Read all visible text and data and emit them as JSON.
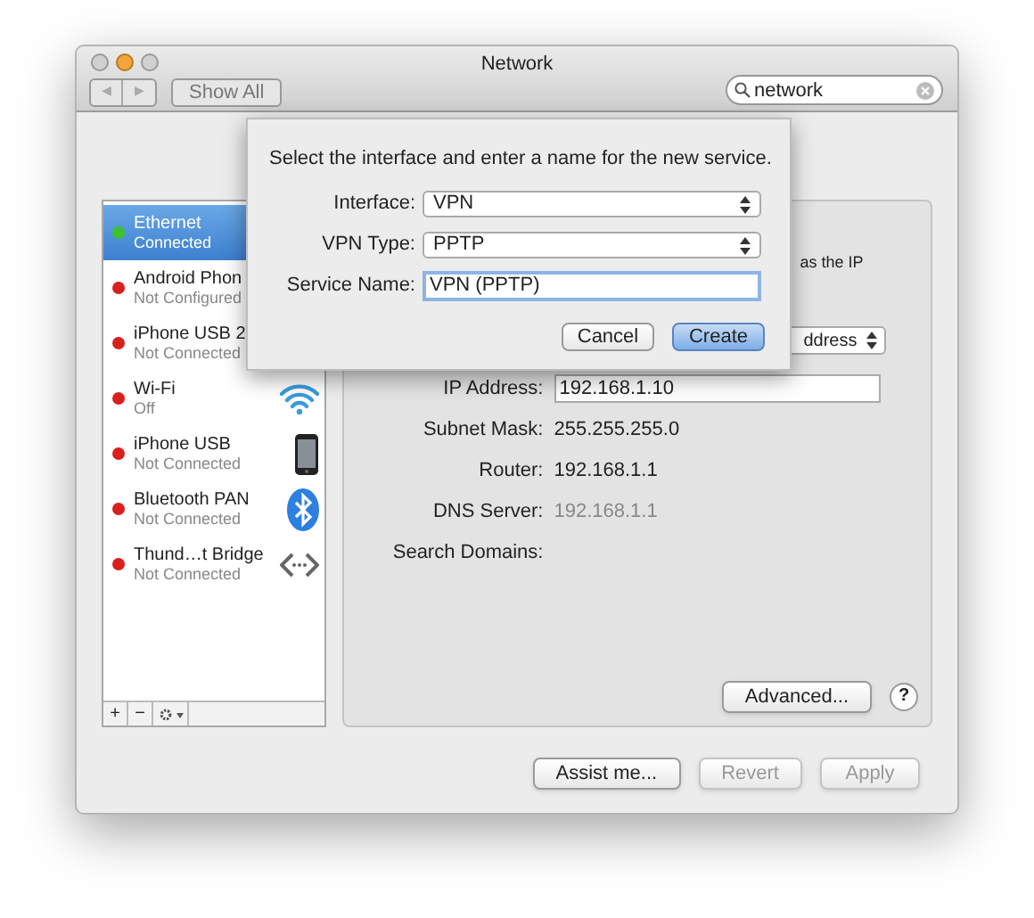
{
  "window": {
    "title": "Network"
  },
  "toolbar": {
    "back": "◀",
    "forward": "▶",
    "show_all": "Show All",
    "search": {
      "value": "network"
    }
  },
  "sidebar": {
    "items": [
      {
        "name": "Ethernet",
        "status": "Connected",
        "color": "#3ec22b",
        "selected": true,
        "kind": "none"
      },
      {
        "name": "Android Phon",
        "status": "Not Configured",
        "color": "#d9201c",
        "selected": false,
        "kind": "none"
      },
      {
        "name": "iPhone USB 2",
        "status": "Not Connected",
        "color": "#d9201c",
        "selected": false,
        "kind": "none"
      },
      {
        "name": "Wi-Fi",
        "status": "Off",
        "color": "#d9201c",
        "selected": false,
        "kind": "wifi"
      },
      {
        "name": "iPhone USB",
        "status": "Not Connected",
        "color": "#d9201c",
        "selected": false,
        "kind": "phone"
      },
      {
        "name": "Bluetooth PAN",
        "status": "Not Connected",
        "color": "#d9201c",
        "selected": false,
        "kind": "bluetooth"
      },
      {
        "name": "Thund…t Bridge",
        "status": "Not Connected",
        "color": "#d9201c",
        "selected": false,
        "kind": "bridge"
      }
    ],
    "buttons": [
      "+",
      "−"
    ]
  },
  "details": {
    "status_fragment": "as the IP",
    "configure_fragment": "ddress",
    "fields": [
      {
        "label": "IP Address:",
        "value": "192.168.1.10",
        "kind": "field",
        "disabled": false
      },
      {
        "label": "Subnet Mask:",
        "value": "255.255.255.0",
        "kind": "text",
        "disabled": false
      },
      {
        "label": "Router:",
        "value": "192.168.1.1",
        "kind": "text",
        "disabled": false
      },
      {
        "label": "DNS Server:",
        "value": "192.168.1.1",
        "kind": "text",
        "disabled": true
      },
      {
        "label": "Search Domains:",
        "kind": "text",
        "disabled": false
      }
    ],
    "advanced": "Advanced...",
    "help": "?"
  },
  "footer": {
    "buttons": [
      {
        "label": "Assist me...",
        "disabled": false
      },
      {
        "label": "Revert",
        "disabled": true
      },
      {
        "label": "Apply",
        "disabled": true
      }
    ]
  },
  "dialog": {
    "message": "Select the interface and enter a name for the new service.",
    "rows": [
      {
        "label": "Interface:",
        "value": "VPN",
        "kind": "popup"
      },
      {
        "label": "VPN Type:",
        "value": "PPTP",
        "kind": "popup"
      },
      {
        "label": "Service Name:",
        "value": "VPN (PPTP)",
        "kind": "input"
      }
    ],
    "buttons": [
      {
        "label": "Cancel",
        "default": false
      },
      {
        "label": "Create",
        "default": true
      }
    ]
  }
}
